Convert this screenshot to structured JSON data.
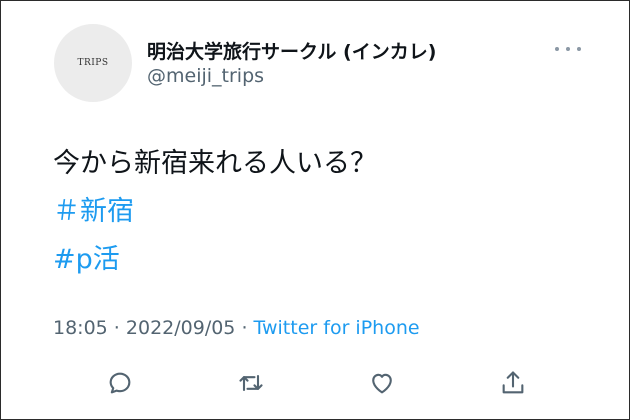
{
  "tweet": {
    "avatar_text": "TRIPS",
    "display_name": "明治大学旅行サークル (インカレ)",
    "handle": "@meiji_trips",
    "text": "今から新宿来れる人いる？",
    "hashtags": [
      "＃新宿",
      "#p活"
    ],
    "time": "18:05",
    "separator1": " · ",
    "date": "2022/09/05",
    "separator2": " · ",
    "source": "Twitter for iPhone"
  },
  "icons": {
    "more": "more-horizontal-icon",
    "reply": "reply-icon",
    "retweet": "retweet-icon",
    "like": "heart-icon",
    "share": "share-icon"
  },
  "colors": {
    "accent": "#1d9bf0",
    "text": "#0f1419",
    "secondary": "#536471"
  }
}
